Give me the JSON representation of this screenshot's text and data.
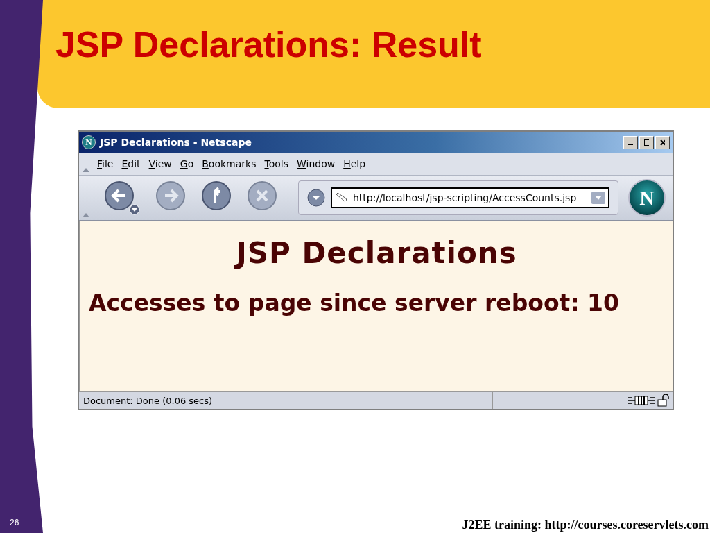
{
  "slide": {
    "title": "JSP Declarations: Result",
    "page_number": "26",
    "footer": "J2EE training: http://courses.coreservlets.com"
  },
  "browser": {
    "icon_letter": "N",
    "title": "JSP Declarations - Netscape",
    "menu": [
      "File",
      "Edit",
      "View",
      "Go",
      "Bookmarks",
      "Tools",
      "Window",
      "Help"
    ],
    "address": "http://localhost/jsp-scripting/AccessCounts.jsp",
    "logo_letter": "N",
    "page": {
      "heading": "JSP Declarations",
      "text": "Accesses to page since server reboot: 10"
    },
    "status": "Document: Done (0.06 secs)"
  }
}
